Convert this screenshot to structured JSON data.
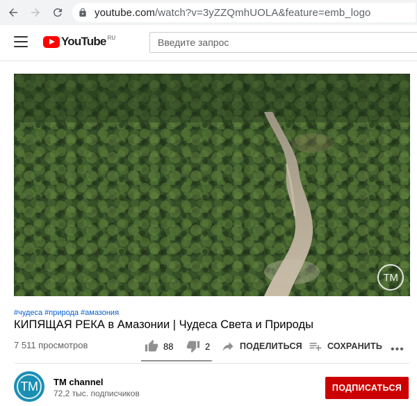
{
  "browser": {
    "url_host": "youtube.com",
    "url_path": "/watch?v=3yZZQmhUOLA&feature=emb_logo"
  },
  "header": {
    "logo_text": "YouTube",
    "logo_region": "RU",
    "search_placeholder": "Введите запрос"
  },
  "video": {
    "watermark": "TM",
    "hashtags": [
      "#чудеса",
      "#природа",
      "#амазония"
    ],
    "title": "КИПЯЩАЯ РЕКА в Амазонии | Чудеса Света и Природы",
    "views": "7 511 просмотров",
    "likes": "88",
    "dislikes": "2",
    "like_ratio": 0.978,
    "share_label": "ПОДЕЛИТЬСЯ",
    "save_label": "СОХРАНИТЬ",
    "more_label": "•••"
  },
  "channel": {
    "avatar_text": "TM",
    "name": "TM channel",
    "subscribers": "72,2 тыс. подписчиков",
    "subscribe_label": "ПОДПИСАТЬСЯ"
  },
  "colors": {
    "brand_red": "#ff0000",
    "subscribe_red": "#cc0000",
    "link_blue": "#065fd4",
    "avatar_blue": "#1a8fb3"
  }
}
